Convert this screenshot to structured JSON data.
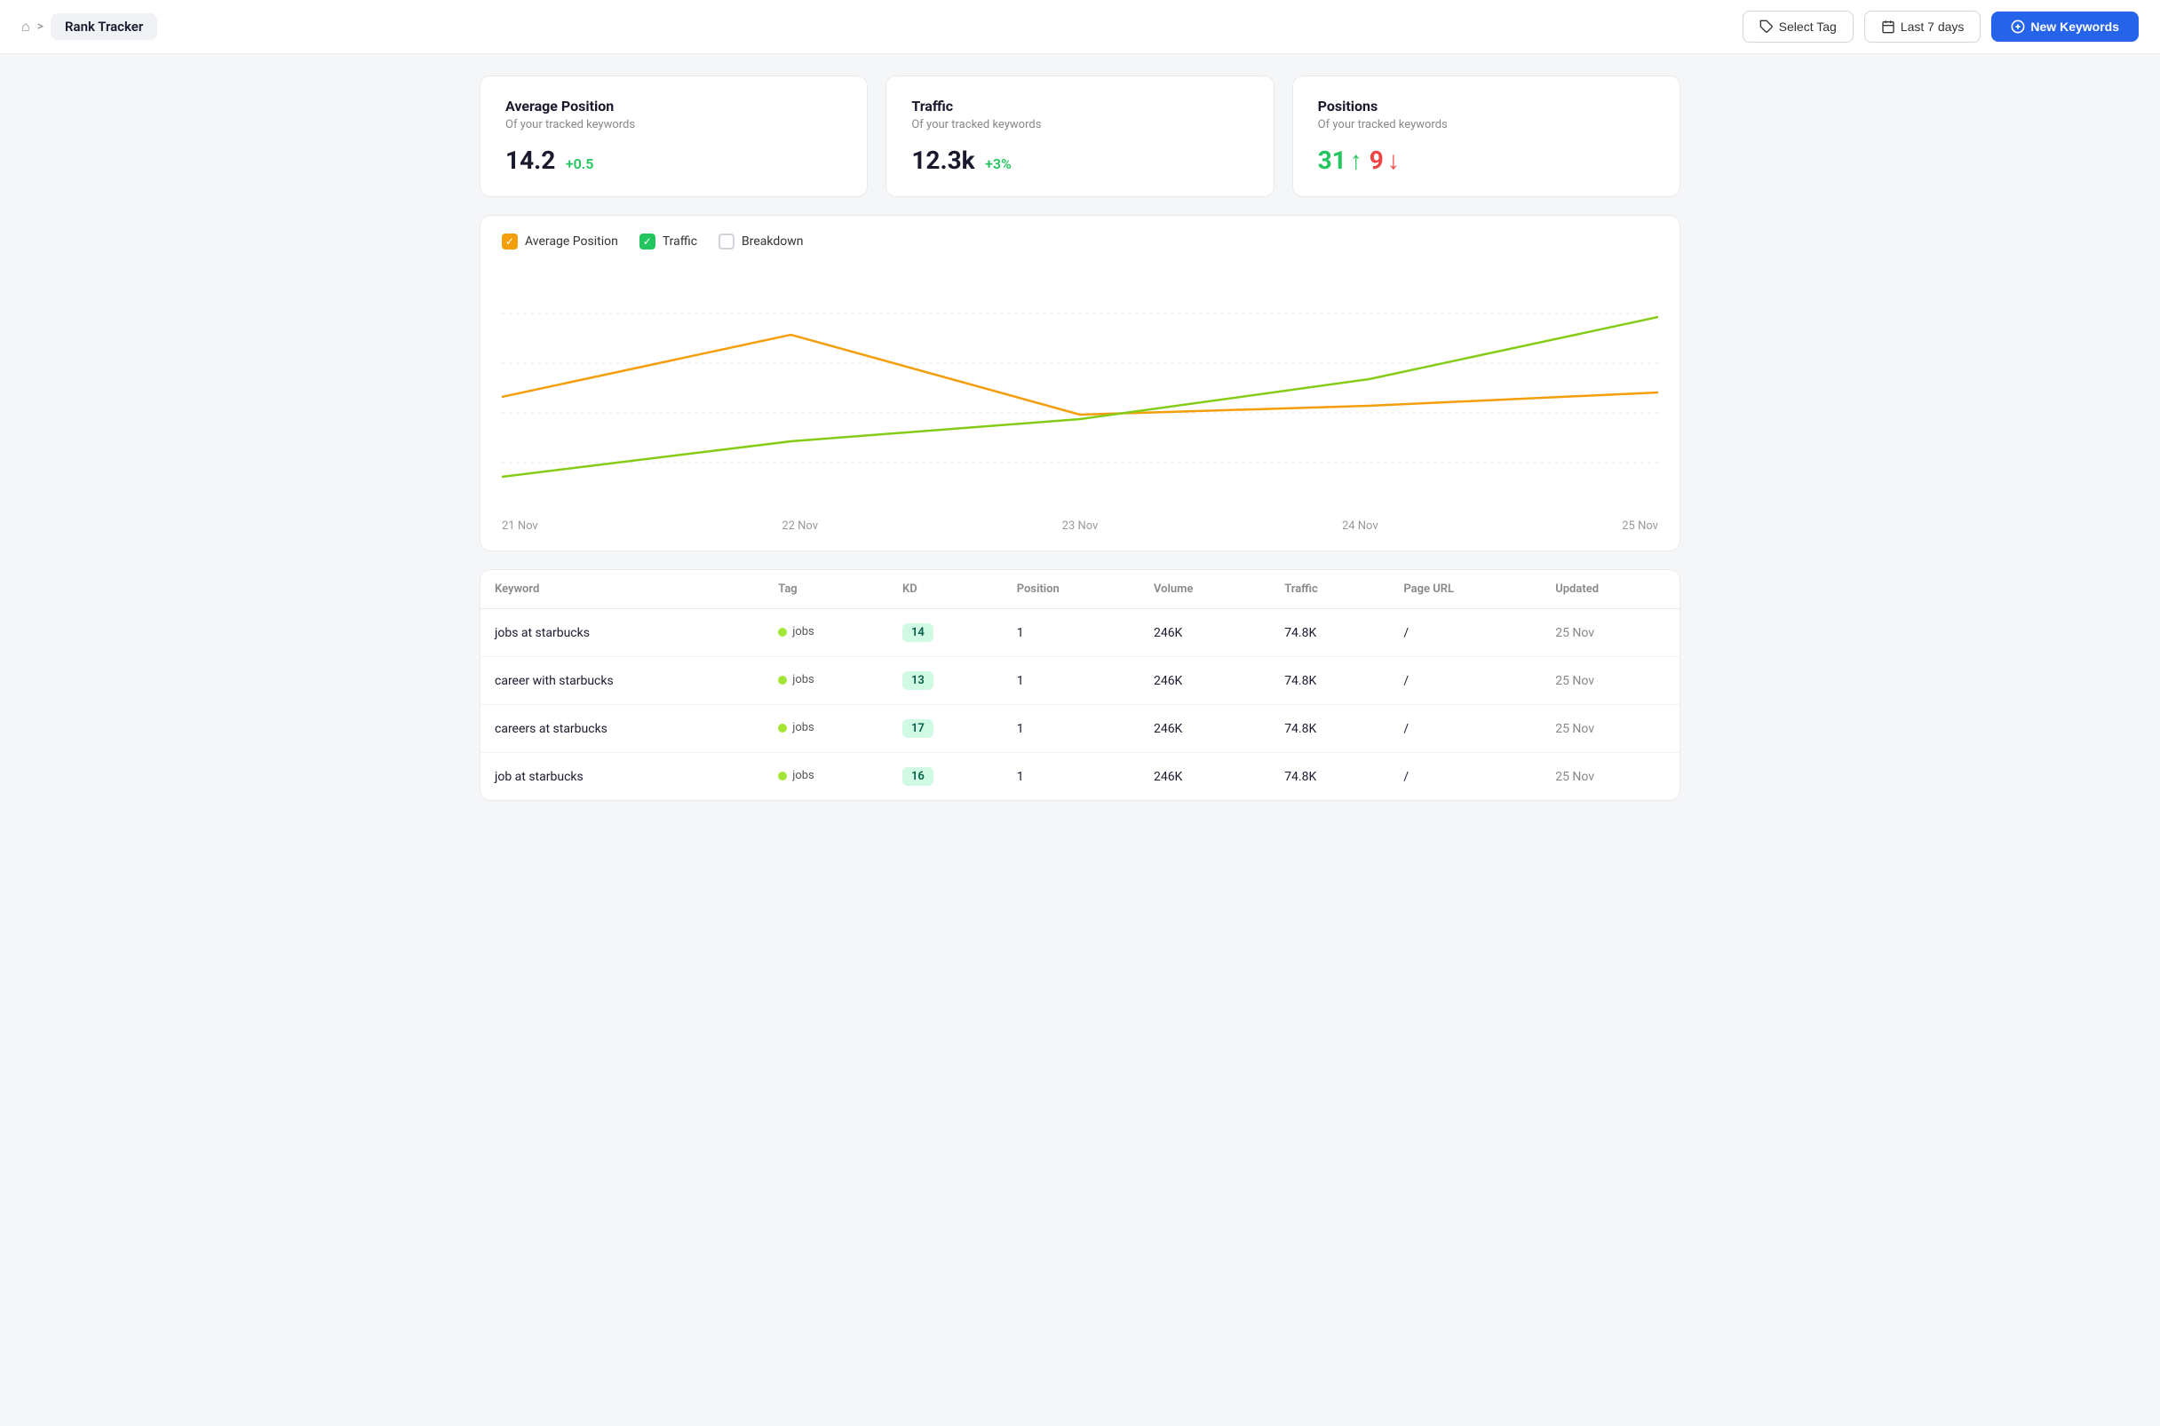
{
  "header": {
    "home_icon": "🏠",
    "breadcrumb_sep": ">",
    "page_title": "Rank Tracker",
    "select_tag_label": "Select Tag",
    "last_days_label": "Last 7 days",
    "new_keywords_label": "New Keywords"
  },
  "stats": {
    "average_position": {
      "title": "Average Position",
      "subtitle": "Of your tracked keywords",
      "value": "14.2",
      "change": "+0.5"
    },
    "traffic": {
      "title": "Traffic",
      "subtitle": "Of your tracked keywords",
      "value": "12.3k",
      "change": "+3%"
    },
    "positions": {
      "title": "Positions",
      "subtitle": "Of your tracked keywords",
      "up_value": "31",
      "down_value": "9"
    }
  },
  "chart": {
    "legend": {
      "avg_position": "Average Position",
      "traffic": "Traffic",
      "breakdown": "Breakdown"
    },
    "x_labels": [
      "21 Nov",
      "22 Nov",
      "23 Nov",
      "24 Nov",
      "25 Nov"
    ]
  },
  "table": {
    "columns": [
      "Keyword",
      "Tag",
      "KD",
      "Position",
      "Volume",
      "Traffic",
      "Page URL",
      "Updated"
    ],
    "rows": [
      {
        "keyword": "jobs at starbucks",
        "tag": "jobs",
        "kd": "14",
        "position": "1",
        "volume": "246K",
        "traffic": "74.8K",
        "url": "/",
        "updated": "25 Nov"
      },
      {
        "keyword": "career with starbucks",
        "tag": "jobs",
        "kd": "13",
        "position": "1",
        "volume": "246K",
        "traffic": "74.8K",
        "url": "/",
        "updated": "25 Nov"
      },
      {
        "keyword": "careers at starbucks",
        "tag": "jobs",
        "kd": "17",
        "position": "1",
        "volume": "246K",
        "traffic": "74.8K",
        "url": "/",
        "updated": "25 Nov"
      },
      {
        "keyword": "job at starbucks",
        "tag": "jobs",
        "kd": "16",
        "position": "1",
        "volume": "246K",
        "traffic": "74.8K",
        "url": "/",
        "updated": "25 Nov"
      }
    ]
  }
}
